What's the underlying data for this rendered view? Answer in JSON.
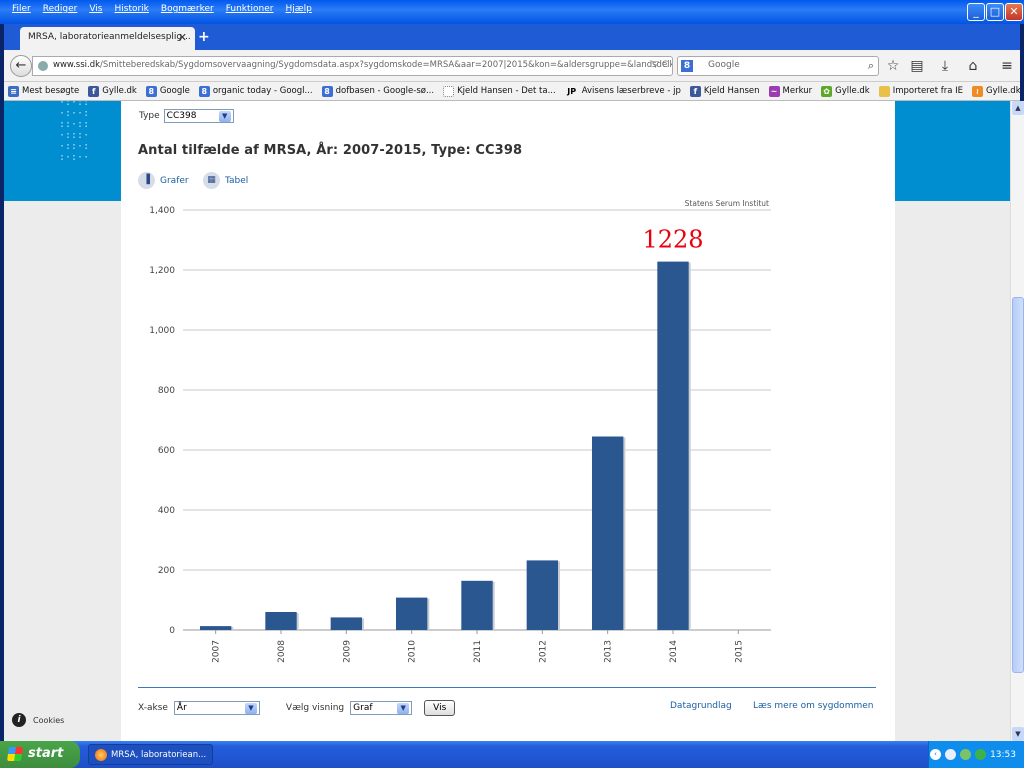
{
  "menu": [
    "Filer",
    "Rediger",
    "Vis",
    "Historik",
    "Bogmærker",
    "Funktioner",
    "Hjælp"
  ],
  "tab": {
    "title": "MRSA, laboratorieanmeldelsesplig..."
  },
  "nav": {
    "url_domain": "www.ssi.dk",
    "url_path": "/Smitteberedskab/Sygdomsovervaagning/Sygdomsdata.aspx?sygdomskode=MRSA&aar=2007|2015&kon=&aldersgruppe=&landsdelkode=&",
    "search_placeholder": "Google"
  },
  "bookmarks": [
    {
      "label": "Mest besøgte",
      "icon": "page-icon",
      "color": "#3c6fc4",
      "glyph": "≡"
    },
    {
      "label": "Gylle.dk",
      "icon": "facebook-icon",
      "color": "#3b5998",
      "glyph": "f"
    },
    {
      "label": "Google",
      "icon": "google-icon",
      "color": "#3b6fd6",
      "glyph": "8"
    },
    {
      "label": "organic today - Googl...",
      "icon": "google-icon",
      "color": "#3b6fd6",
      "glyph": "8"
    },
    {
      "label": "dofbasen - Google-sø...",
      "icon": "google-icon",
      "color": "#3b6fd6",
      "glyph": "8"
    },
    {
      "label": "Kjeld Hansen - Det ta...",
      "icon": "blank-page-icon",
      "color": "#ffffff",
      "glyph": ""
    },
    {
      "label": "Avisens læserbreve - jp",
      "icon": "jp-icon",
      "color": "#f2f2f2",
      "glyph": "JP"
    },
    {
      "label": "Kjeld Hansen",
      "icon": "facebook-icon",
      "color": "#3b5998",
      "glyph": "f"
    },
    {
      "label": "Merkur",
      "icon": "merkur-icon",
      "color": "#9b3cb0",
      "glyph": "~"
    },
    {
      "label": "Gylle.dk",
      "icon": "clover-icon",
      "color": "#5ea829",
      "glyph": "✿"
    },
    {
      "label": "Importeret fra IE",
      "icon": "folder-icon",
      "color": "#e8c04a",
      "glyph": ""
    },
    {
      "label": "Gylle.dk",
      "icon": "rss-icon",
      "color": "#f08a24",
      "glyph": "≀"
    },
    {
      "label": "Gylle.dk",
      "icon": "rss-icon",
      "color": "#f08a24",
      "glyph": "≀"
    }
  ],
  "page": {
    "type_label": "Type",
    "type_value": "CC398",
    "heading": "Antal tilfælde af MRSA, År: 2007-2015, Type: CC398",
    "view_graph": "Grafer",
    "view_table": "Tabel",
    "xaxis_label": "X-akse",
    "xaxis_value": "År",
    "view_label": "Vælg visning",
    "view_value": "Graf",
    "show_button": "Vis",
    "link_data": "Datagrundlag",
    "link_more": "Læs mere om sygdommen",
    "cookies": "Cookies"
  },
  "chart_data": {
    "type": "bar",
    "categories": [
      "2007",
      "2008",
      "2009",
      "2010",
      "2011",
      "2012",
      "2013",
      "2014",
      "2015"
    ],
    "values": [
      13,
      60,
      42,
      108,
      164,
      232,
      645,
      1228,
      0
    ],
    "ylim": [
      0,
      1400
    ],
    "yticks": [
      "0",
      "200",
      "400",
      "600",
      "800",
      "1,000",
      "1,200",
      "1,400"
    ],
    "ytick_values": [
      0,
      200,
      400,
      600,
      800,
      1000,
      1200,
      1400
    ],
    "credit": "Statens Serum Institut",
    "annotation": "1228",
    "bar_color": "#2b5790",
    "annotation_color": "#e8000d",
    "grid": true
  },
  "taskbar": {
    "start": "start",
    "task": "MRSA, laboratoriean...",
    "time": "13:53"
  }
}
